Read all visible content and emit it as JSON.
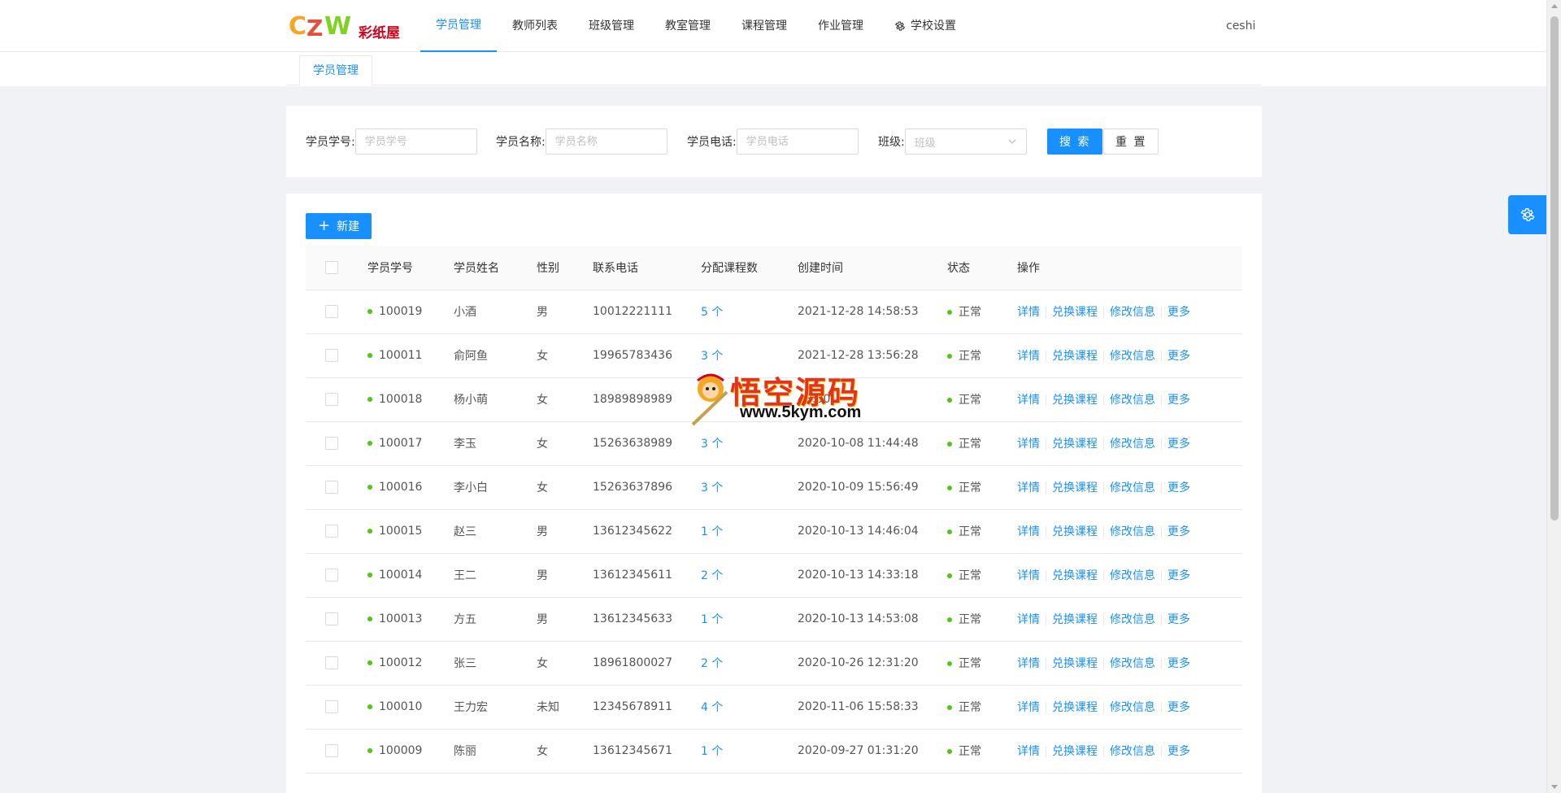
{
  "brand": {
    "logo_text": "CZW",
    "logo_subtext": "彩纸屋"
  },
  "nav": {
    "items": [
      {
        "label": "学员管理",
        "active": true
      },
      {
        "label": "教师列表"
      },
      {
        "label": "班级管理"
      },
      {
        "label": "教室管理"
      },
      {
        "label": "课程管理"
      },
      {
        "label": "作业管理"
      },
      {
        "label": "学校设置",
        "icon": "gear-icon"
      }
    ]
  },
  "user": {
    "name": "ceshi"
  },
  "tabs": [
    {
      "label": "学员管理",
      "active": true
    }
  ],
  "search": {
    "student_id": {
      "label": "学员学号:",
      "placeholder": "学员学号",
      "value": ""
    },
    "student_name": {
      "label": "学员名称:",
      "placeholder": "学员名称",
      "value": ""
    },
    "student_phone": {
      "label": "学员电话:",
      "placeholder": "学员电话",
      "value": ""
    },
    "class": {
      "label": "班级:",
      "placeholder": "班级"
    },
    "search_button": "搜 索",
    "reset_button": "重 置"
  },
  "toolbar": {
    "new_button": "新建"
  },
  "table": {
    "columns": [
      "学员学号",
      "学员姓名",
      "性别",
      "联系电话",
      "分配课程数",
      "创建时间",
      "状态",
      "操作"
    ],
    "actions": {
      "detail": "详情",
      "exchange": "兑换课程",
      "edit": "修改信息",
      "more": "更多"
    },
    "rows": [
      {
        "id": "100019",
        "name": "小酒",
        "gender": "男",
        "phone": "10012221111",
        "courses": "5 个",
        "created": "2021-12-28 14:58:53",
        "status": "正常"
      },
      {
        "id": "100011",
        "name": "俞阿鱼",
        "gender": "女",
        "phone": "19965783436",
        "courses": "3 个",
        "created": "2021-12-28 13:56:28",
        "status": "正常"
      },
      {
        "id": "100018",
        "name": "杨小萌",
        "gender": "女",
        "phone": "18989898989",
        "courses": "",
        "created": "48:50",
        "status": "正常"
      },
      {
        "id": "100017",
        "name": "李玉",
        "gender": "女",
        "phone": "15263638989",
        "courses": "3 个",
        "created": "2020-10-08 11:44:48",
        "status": "正常"
      },
      {
        "id": "100016",
        "name": "李小白",
        "gender": "女",
        "phone": "15263637896",
        "courses": "3 个",
        "created": "2020-10-09 15:56:49",
        "status": "正常"
      },
      {
        "id": "100015",
        "name": "赵三",
        "gender": "男",
        "phone": "13612345622",
        "courses": "1 个",
        "created": "2020-10-13 14:46:04",
        "status": "正常"
      },
      {
        "id": "100014",
        "name": "王二",
        "gender": "男",
        "phone": "13612345611",
        "courses": "2 个",
        "created": "2020-10-13 14:33:18",
        "status": "正常"
      },
      {
        "id": "100013",
        "name": "方五",
        "gender": "男",
        "phone": "13612345633",
        "courses": "1 个",
        "created": "2020-10-13 14:53:08",
        "status": "正常"
      },
      {
        "id": "100012",
        "name": "张三",
        "gender": "女",
        "phone": "18961800027",
        "courses": "2 个",
        "created": "2020-10-26 12:31:20",
        "status": "正常"
      },
      {
        "id": "100010",
        "name": "王力宏",
        "gender": "未知",
        "phone": "12345678911",
        "courses": "4 个",
        "created": "2020-11-06 15:58:33",
        "status": "正常"
      },
      {
        "id": "100009",
        "name": "陈丽",
        "gender": "女",
        "phone": "13612345671",
        "courses": "1 个",
        "created": "2020-09-27 01:31:20",
        "status": "正常"
      }
    ]
  },
  "watermark": {
    "title": "悟空源码",
    "url": "www.5kym.com"
  },
  "colors": {
    "primary": "#1890ff",
    "status_ok": "#52c41a",
    "background": "#f0f2f5"
  }
}
